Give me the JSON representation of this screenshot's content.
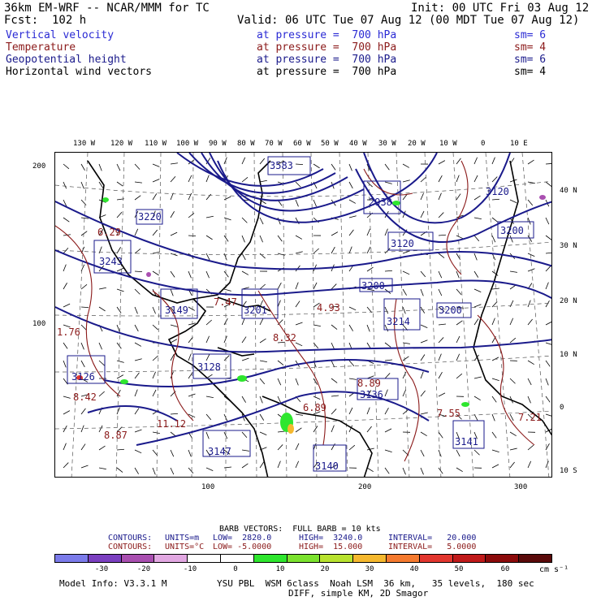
{
  "header": {
    "model": "36km EM-WRF -- NCAR/MMM for TC",
    "init": "Init: 00 UTC Fri 03 Aug 12",
    "fcst": "Fcst:  102 h",
    "valid": "Valid: 06 UTC Tue 07 Aug 12 (00 MDT Tue 07 Aug 12)"
  },
  "fields": [
    {
      "name": "Vertical velocity",
      "level": "at pressure =  700 hPa",
      "sm": "sm= 6",
      "color": "#2a2ad4"
    },
    {
      "name": "Temperature",
      "level": "at pressure =  700 hPa",
      "sm": "sm= 4",
      "color": "#8b1a1a"
    },
    {
      "name": "Geopotential height",
      "level": "at pressure =  700 hPa",
      "sm": "sm= 6",
      "color": "#1a1a8b"
    },
    {
      "name": "Horizontal wind vectors",
      "level": "at pressure =  700 hPa",
      "sm": "sm= 4",
      "color": "#000000"
    }
  ],
  "lon_labels": [
    "130 W",
    "120 W",
    "110 W",
    "100 W",
    "90 W",
    "80 W",
    "70 W",
    "60 W",
    "50 W",
    "40 W",
    "30 W",
    "20 W",
    "10 W",
    "0",
    "10 E"
  ],
  "lat_labels": [
    "40 N",
    "30 N",
    "20 N",
    "10 N",
    "0",
    "10 S"
  ],
  "grid_left": [
    "200",
    "100"
  ],
  "grid_bottom": [
    "100",
    "200",
    "300"
  ],
  "map_labels": [
    {
      "text": "3583",
      "color": "#1a1a8b"
    },
    {
      "text": "2938",
      "color": "#1a1a8b"
    },
    {
      "text": "3120",
      "color": "#1a1a8b"
    },
    {
      "text": "3120",
      "color": "#1a1a8b"
    },
    {
      "text": "3200",
      "color": "#1a1a8b"
    },
    {
      "text": "3200",
      "color": "#1a1a8b"
    },
    {
      "text": "3201",
      "color": "#1a1a8b"
    },
    {
      "text": "3214",
      "color": "#1a1a8b"
    },
    {
      "text": "3243",
      "color": "#1a1a8b"
    },
    {
      "text": "3220",
      "color": "#1a1a8b"
    },
    {
      "text": "3149",
      "color": "#1a1a8b"
    },
    {
      "text": "3147",
      "color": "#1a1a8b"
    },
    {
      "text": "3140",
      "color": "#1a1a8b"
    },
    {
      "text": "3141",
      "color": "#1a1a8b"
    },
    {
      "text": "3136",
      "color": "#1a1a8b"
    },
    {
      "text": "3128",
      "color": "#1a1a8b"
    },
    {
      "text": "3126",
      "color": "#1a1a8b"
    },
    {
      "text": "3200",
      "color": "#1a1a8b"
    },
    {
      "text": "4.93",
      "color": "#8b1a1a"
    },
    {
      "text": "8.32",
      "color": "#8b1a1a"
    },
    {
      "text": "8.42",
      "color": "#8b1a1a"
    },
    {
      "text": "8.87",
      "color": "#8b1a1a"
    },
    {
      "text": "11.12",
      "color": "#8b1a1a"
    },
    {
      "text": "8.89",
      "color": "#8b1a1a"
    },
    {
      "text": "6.89",
      "color": "#8b1a1a"
    },
    {
      "text": "7.55",
      "color": "#8b1a1a"
    },
    {
      "text": "7.21",
      "color": "#8b1a1a"
    },
    {
      "text": "7.47",
      "color": "#8b1a1a"
    },
    {
      "text": "1.76",
      "color": "#8b1a1a"
    },
    {
      "text": "6.29",
      "color": "#8b1a1a"
    }
  ],
  "barb_info": "BARB VECTORS:  FULL BARB = 10 kts",
  "contours": [
    {
      "label": "CONTOURS:",
      "units": "UNITS=m",
      "low": "LOW=  2820.0",
      "high": "HIGH=  3240.0",
      "interval": "INTERVAL=   20.000",
      "color": "#1a1a8b"
    },
    {
      "label": "CONTOURS:",
      "units": "UNITS=°C",
      "low": "LOW= -5.0000",
      "high": "HIGH=  15.000",
      "interval": "INTERVAL=   5.0000",
      "color": "#8b1a1a"
    }
  ],
  "colorbar": {
    "colors": [
      "#7b7bea",
      "#7b3fc0",
      "#a94fb0",
      "#e2a8e2",
      "#ffffff",
      "#ffffff",
      "#2ee62e",
      "#7be22e",
      "#b8e22e",
      "#f5b82e",
      "#f57a2e",
      "#e2362e",
      "#c01a1a",
      "#8b0a0a",
      "#5a0a0a"
    ],
    "labels": [
      "-30",
      "-20",
      "-10",
      "0",
      "10",
      "20",
      "30",
      "40",
      "50",
      "60"
    ],
    "unit": "cm s⁻¹"
  },
  "footer": {
    "model_info": "Model Info: V3.3.1 M",
    "physics": "YSU PBL  WSM 6class  Noah LSM  36 km,   35 levels,  180 sec",
    "diff": "DIFF, simple KM, 2D Smagor"
  }
}
